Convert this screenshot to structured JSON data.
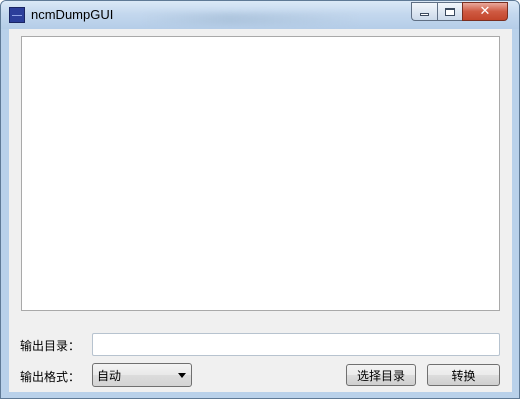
{
  "window": {
    "title": "ncmDumpGUI"
  },
  "title_controls": {
    "minimize_icon": "minimize-icon",
    "maximize_icon": "maximize-icon",
    "close_icon": "close-icon",
    "close_glyph": "✕"
  },
  "form": {
    "output_dir_label": "输出目录：",
    "output_dir_value": "",
    "output_format_label": "输出格式：",
    "output_format_selected": "自动",
    "choose_dir_button": "选择目录",
    "convert_button": "转换"
  },
  "colors": {
    "titlebar": "#c4d8ee",
    "client_background": "#f0f0f0",
    "close_button": "#cf5a42"
  }
}
